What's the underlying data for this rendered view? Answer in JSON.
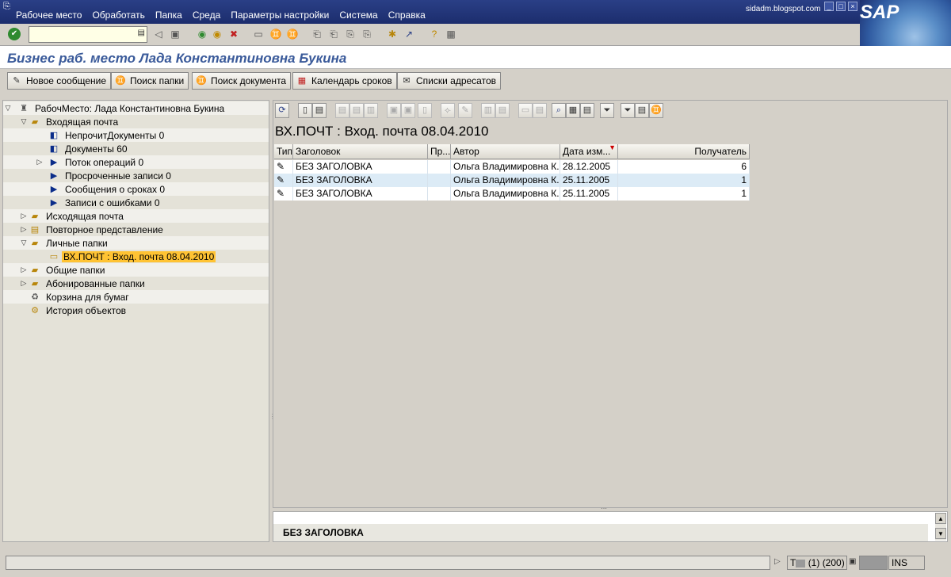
{
  "menu": {
    "items": [
      "Рабочее место",
      "Обработать",
      "Папка",
      "Среда",
      "Параметры настройки",
      "Система",
      "Справка"
    ],
    "watermark": "sidadm.blogspot.com",
    "logo": "SAP"
  },
  "title": "Бизнес раб. место Лада Константиновна Букина",
  "app_toolbar": {
    "buttons": [
      "Новое сообщение",
      "Поиск папки",
      "Поиск документа",
      "Календарь сроков",
      "Списки адресатов"
    ]
  },
  "tree": {
    "root": "РабочМесто: Лада Константиновна Букина",
    "inbox": "Входящая почта",
    "inbox_children": [
      "НепрочитДокументы 0",
      "Документы 60",
      "Поток операций 0",
      "Просроченные записи 0",
      "Сообщения о сроках 0",
      "Записи с ошибками 0"
    ],
    "outbox": "Исходящая почта",
    "resubmission": "Повторное представление",
    "personal": "Личные папки",
    "selected": "ВХ.ПОЧТ : Вход. почта 08.04.2010",
    "shared": "Общие папки",
    "subscribed": "Абонированные папки",
    "trash": "Корзина для бумаг",
    "history": "История объектов"
  },
  "list": {
    "title": "ВХ.ПОЧТ : Вход. почта 08.04.2010",
    "columns": [
      "Тип",
      "Заголовок",
      "Пр...",
      "Автор",
      "Дата изм...",
      "Получатель"
    ],
    "rows": [
      {
        "subject": "БЕЗ ЗАГОЛОВКА",
        "prio": "",
        "author": "Ольга Владимировна К...",
        "date": "28.12.2005",
        "recipients": "6"
      },
      {
        "subject": "БЕЗ ЗАГОЛОВКА",
        "prio": "",
        "author": "Ольга Владимировна К...",
        "date": "25.11.2005",
        "recipients": "1"
      },
      {
        "subject": "БЕЗ ЗАГОЛОВКА",
        "prio": "",
        "author": "Ольга Владимировна К...",
        "date": "25.11.2005",
        "recipients": "1"
      }
    ]
  },
  "preview": {
    "subject": "БЕЗ ЗАГОЛОВКА"
  },
  "status": {
    "system": "T",
    "session": "(1) (200)",
    "mode": "INS"
  },
  "colors": {
    "menubar": "#1c2d6d",
    "title": "#3a5a9a",
    "selection": "#ffc333",
    "row_alt": "#dcebf6"
  }
}
